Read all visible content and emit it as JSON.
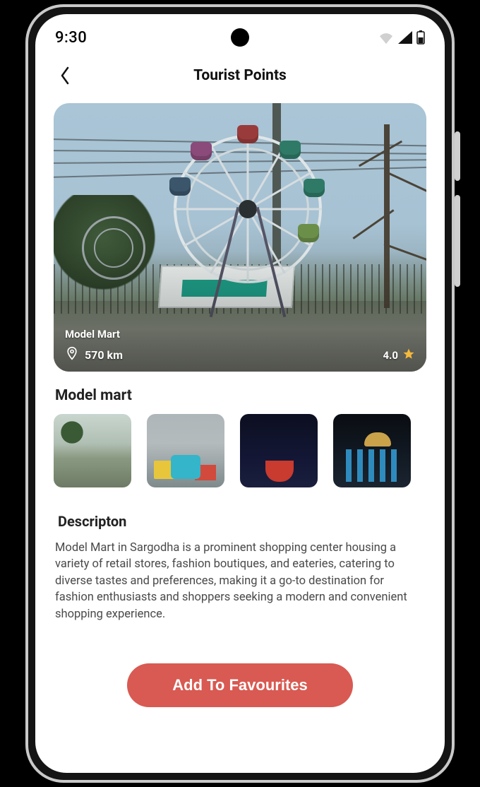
{
  "status": {
    "time": "9:30"
  },
  "header": {
    "title": "Tourist Points"
  },
  "hero": {
    "name": "Model Mart",
    "distance": "570 km",
    "rating": "4.0"
  },
  "section_title": "Model mart",
  "description": {
    "heading": "Descripton",
    "body": "Model Mart in Sargodha is a prominent shopping center housing a variety of retail stores, fashion boutiques, and eateries, catering to diverse tastes and preferences, making it a go-to destination for fashion enthusiasts and shoppers seeking a modern and convenient shopping experience."
  },
  "cta": {
    "label": "Add To Favourites"
  },
  "colors": {
    "accent": "#d85a52",
    "star": "#f6b93b"
  }
}
